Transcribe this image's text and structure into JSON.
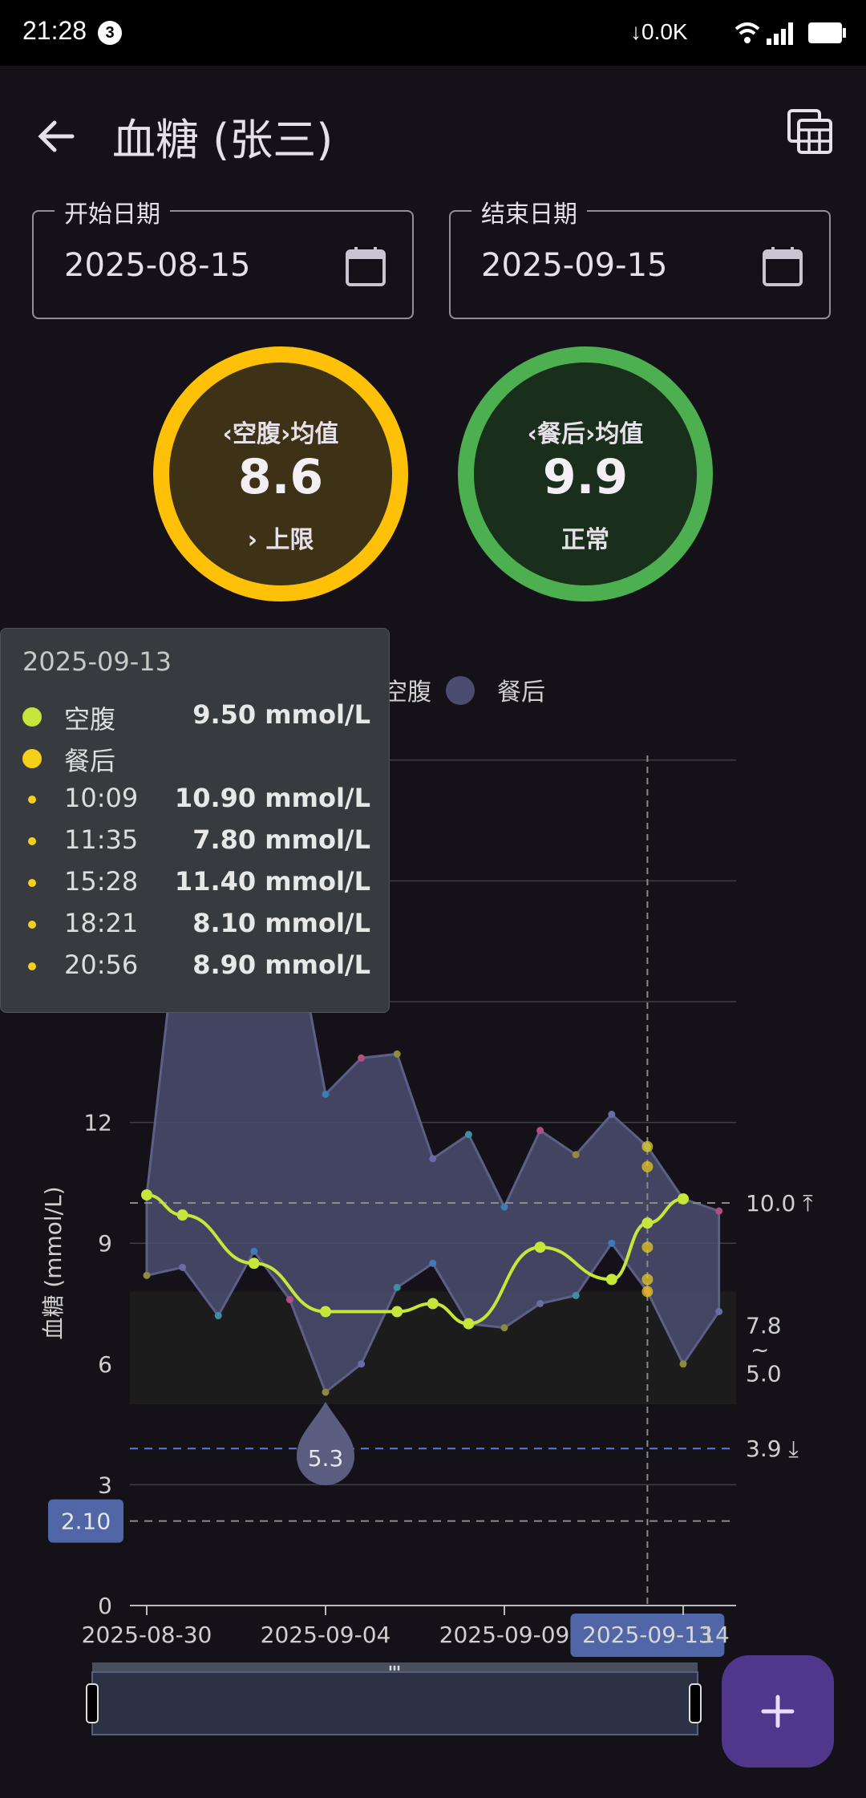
{
  "status_bar": {
    "time": "21:28",
    "badge": "3",
    "net_speed": "↓0.0K",
    "icons": [
      "moon-icon",
      "wifi-icon",
      "signal-icon",
      "battery-icon"
    ]
  },
  "app_bar": {
    "title": "血糖 (张三)",
    "back_icon": "arrow-left-icon",
    "action_icon": "calendar-view-icon"
  },
  "filters": {
    "start": {
      "label": "开始日期",
      "value": "2025-08-15"
    },
    "end": {
      "label": "结束日期",
      "value": "2025-09-15"
    }
  },
  "stats": [
    {
      "label": "‹空腹›均值",
      "value": "8.6",
      "status": "› 上限",
      "ring_color": "#FFC107",
      "fill_color": "#3D3216"
    },
    {
      "label": "‹餐后›均值",
      "value": "9.9",
      "status": "正常",
      "ring_color": "#4CAF50",
      "fill_color": "#1A2E1C"
    }
  ],
  "tooltip": {
    "date": "2025-09-13",
    "rows": [
      {
        "kind": "series",
        "name": "空腹",
        "value": "9.50 mmol/L",
        "color": "#C6E63A"
      },
      {
        "kind": "series",
        "name": "餐后",
        "value": "",
        "color": "#F5D01A"
      },
      {
        "kind": "reading",
        "name": "10:09",
        "value": "10.90 mmol/L"
      },
      {
        "kind": "reading",
        "name": "11:35",
        "value": "7.80 mmol/L"
      },
      {
        "kind": "reading",
        "name": "15:28",
        "value": "11.40 mmol/L"
      },
      {
        "kind": "reading",
        "name": "18:21",
        "value": "8.10 mmol/L"
      },
      {
        "kind": "reading",
        "name": "20:56",
        "value": "8.90 mmol/L"
      }
    ]
  },
  "chart_data": {
    "type": "line",
    "ylabel": "血糖 (mmol/L)",
    "ylim": [
      0,
      21
    ],
    "y_ticks": [
      "0",
      "3",
      "6",
      "9",
      "12"
    ],
    "x_tick_labels": [
      "2025-08-30",
      "2025-09-04",
      "2025-09-09",
      "2025-09-13",
      "14"
    ],
    "legend": [
      {
        "name": "空腹",
        "color": "#C6E63A"
      },
      {
        "name": "餐后",
        "color": "#4A4D70"
      }
    ],
    "series": [
      {
        "name": "空腹",
        "color": "#C6E63A",
        "x": [
          "2025-08-30",
          "2025-08-31",
          "2025-09-02",
          "2025-09-04",
          "2025-09-06",
          "2025-09-07",
          "2025-09-08",
          "2025-09-10",
          "2025-09-12",
          "2025-09-13",
          "2025-09-14"
        ],
        "y": [
          10.2,
          9.7,
          8.5,
          7.3,
          7.3,
          7.5,
          7.0,
          8.9,
          8.1,
          9.5,
          10.1
        ]
      },
      {
        "name": "餐后",
        "color": "#4A4D70",
        "x": [
          "2025-08-30",
          "2025-08-31",
          "2025-09-01",
          "2025-09-02",
          "2025-09-03",
          "2025-09-04",
          "2025-09-05",
          "2025-09-06",
          "2025-09-07",
          "2025-09-08",
          "2025-09-09",
          "2025-09-10",
          "2025-09-11",
          "2025-09-12",
          "2025-09-13",
          "2025-09-14",
          "2025-09-15"
        ],
        "min": [
          8.2,
          8.4,
          7.2,
          8.8,
          7.6,
          5.3,
          6.0,
          7.9,
          8.5,
          7.0,
          6.9,
          7.5,
          7.7,
          9.0,
          7.8,
          6.0,
          7.3
        ],
        "max": [
          10.2,
          18.0,
          19.0,
          19.5,
          17.5,
          12.7,
          13.6,
          13.7,
          11.1,
          11.7,
          9.9,
          11.8,
          11.2,
          12.2,
          11.4,
          10.1,
          9.8
        ]
      }
    ],
    "markers": [
      {
        "label": "5.3",
        "x": "2025-09-04",
        "y": 5.3
      }
    ],
    "reference_lines": [
      {
        "label": "10.0 ⤒",
        "y": 10.0
      },
      {
        "label": "3.9 ⤓",
        "y": 3.9
      },
      {
        "label": "2.10",
        "y": 2.1
      }
    ],
    "target_band": {
      "from": 5.0,
      "to": 7.8,
      "label_top": "7.8",
      "label_mid": "~",
      "label_bottom": "5.0"
    },
    "crosshair": {
      "x": "2025-09-13",
      "label": "2025-09-13"
    },
    "zoom_window": [
      0.0,
      1.0
    ],
    "grid": true
  },
  "fab": {
    "icon": "plus-icon"
  }
}
